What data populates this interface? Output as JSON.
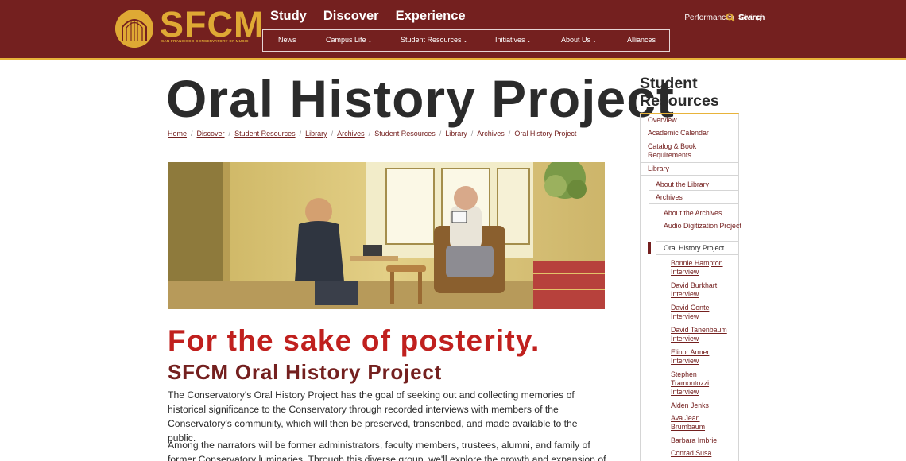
{
  "brand": {
    "logo_text": "SFCM",
    "logo_tagline": "SAN FRANCISCO CONSERVATORY OF MUSIC",
    "colors": {
      "maroon": "#74201f",
      "gold": "#e8b33a",
      "red": "#c0201e"
    }
  },
  "primary_nav": [
    "Study",
    "Discover",
    "Experience"
  ],
  "util_nav": {
    "performances": "Performances",
    "giving": "Giving",
    "search": "Search",
    "search_icon": "search-icon"
  },
  "sub_nav": {
    "news": "News",
    "campus_life": "Campus Life",
    "student_resources": "Student Resources",
    "initiatives": "Initiatives",
    "about_us": "About Us",
    "alliances": "Alliances",
    "caret": "⌄"
  },
  "page": {
    "title": "Oral History Project"
  },
  "breadcrumb": [
    "Home",
    "Discover",
    "Student Resources",
    "Library",
    "Archives",
    "Student Resources",
    "Library",
    "Archives",
    "Oral History Project"
  ],
  "breadcrumb_sep": "/",
  "content": {
    "heading1": "For the sake of posterity.",
    "heading2": "SFCM Oral History Project",
    "para1": "The Conservatory's Oral History Project has the goal of seeking out and collecting memories of historical significance to the Conservatory through recorded interviews with members of the Conservatory's community, which will then be preserved, transcribed, and made available to the public.",
    "para2": "Among the narrators will be former administrators, faculty members, trustees, alumni, and family of former Conservatory luminaries. Through this diverse group, we'll explore the growth and expansion of the"
  },
  "sidebar": {
    "title": "Student Resources",
    "overview": "Overview",
    "academic_calendar": "Academic Calendar",
    "catalog": "Catalog & Book Requirements",
    "library": "Library",
    "about_library": "About the Library",
    "archives": "Archives",
    "about_archives": "About the Archives",
    "audio_digitization": "Audio Digitization Project",
    "oral_history": "Oral History Project",
    "interviews": [
      "Bonnie Hampton Interview",
      "David Burkhart Interview",
      "David Conte Interview",
      "David Tanenbaum Interview",
      "Elinor Armer Interview",
      "Stephen Tramontozzi Interview",
      "Alden Jenks",
      "Ava Jean Brumbaum",
      "Barbara Imbrie",
      "Conrad Susa"
    ]
  }
}
